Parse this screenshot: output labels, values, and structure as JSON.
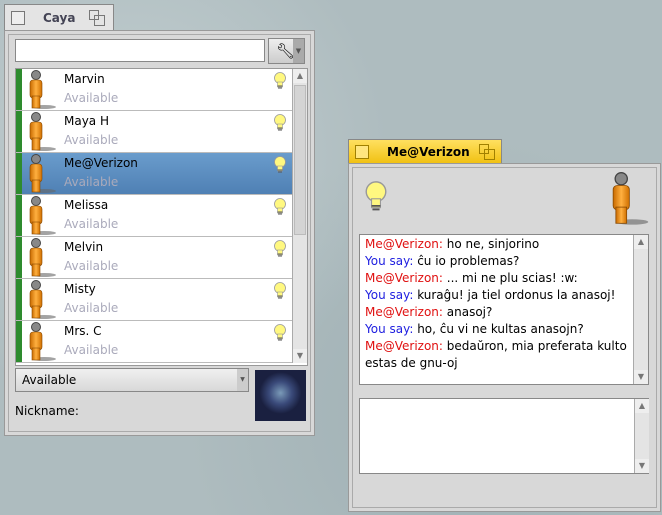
{
  "contacts_window": {
    "title": "Caya",
    "search_value": "",
    "contacts": [
      {
        "name": "Marvin",
        "status": "Available",
        "selected": false
      },
      {
        "name": "Maya H",
        "status": "Available",
        "selected": false
      },
      {
        "name": "Me@Verizon",
        "status": "Available",
        "selected": true
      },
      {
        "name": "Melissa",
        "status": "Available",
        "selected": false
      },
      {
        "name": "Melvin",
        "status": "Available",
        "selected": false
      },
      {
        "name": "Misty",
        "status": "Available",
        "selected": false
      },
      {
        "name": "Mrs. C",
        "status": "Available",
        "selected": false
      }
    ],
    "status_select": "Available",
    "nickname_label": "Nickname:",
    "nickname_value": ""
  },
  "chat_window": {
    "title": "Me@Verizon",
    "messages": [
      {
        "sender": "Me@Verizon:",
        "text": " ho ne, sinjorino",
        "from": "them"
      },
      {
        "sender": "You say:",
        "text": " ĉu io problemas?",
        "from": "you"
      },
      {
        "sender": "Me@Verizon:",
        "text": " ... mi ne plu scias! :w:",
        "from": "them"
      },
      {
        "sender": "You say:",
        "text": " kuraĝu! ja tiel ordonus la anasoj!",
        "from": "you"
      },
      {
        "sender": "Me@Verizon:",
        "text": " anasoj?",
        "from": "them"
      },
      {
        "sender": "You say:",
        "text": " ho, ĉu vi ne kultas anasojn?",
        "from": "you"
      },
      {
        "sender": "Me@Verizon:",
        "text": " bedaŭron, mia preferata kulto estas de gnu-oj",
        "from": "them"
      }
    ],
    "input_value": ""
  },
  "colors": {
    "available": "#2e8b2e",
    "selection": "#5a8cc0",
    "active_tab": "#f8d030",
    "them": "#e01010",
    "you": "#2020e0"
  }
}
